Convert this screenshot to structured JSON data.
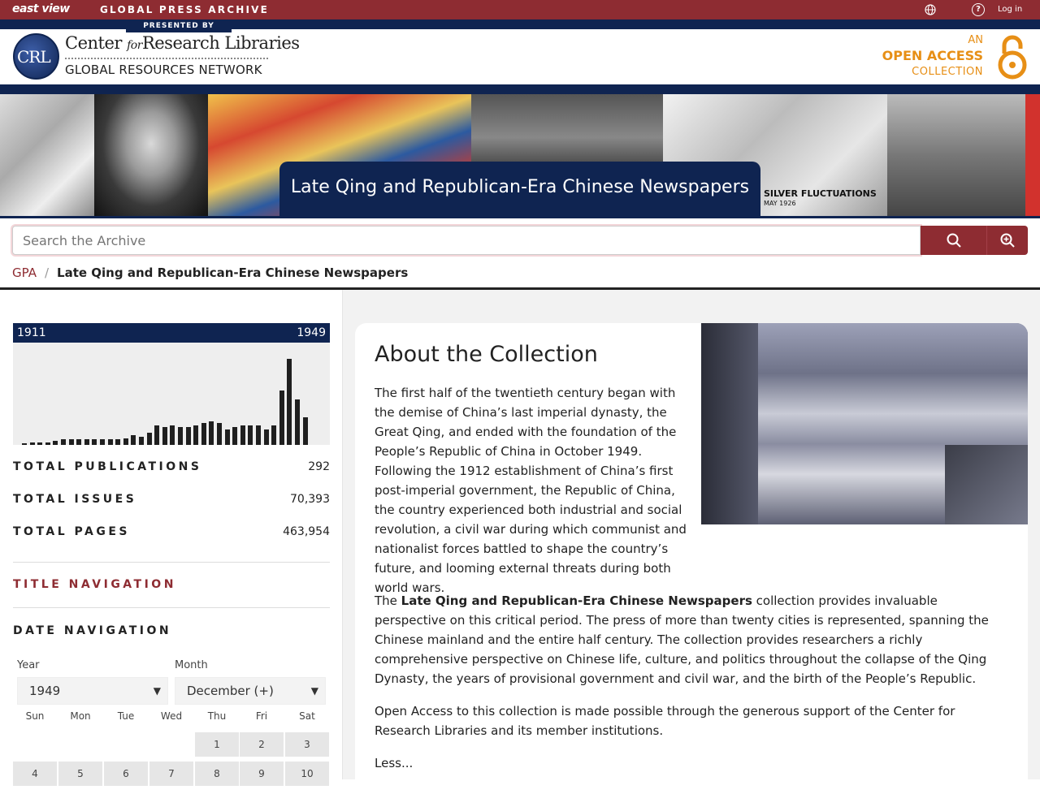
{
  "topbar": {
    "logo": "east view",
    "title": "GLOBAL PRESS ARCHIVE",
    "login": "Log in",
    "help": "?"
  },
  "header": {
    "presented_by": "PRESENTED BY",
    "crl_abbr": "CRL",
    "crl_line1_a": "Center",
    "crl_line1_for": "for",
    "crl_line1_b": "Research Libraries",
    "crl_line2": "GLOBAL RESOURCES NETWORK",
    "oa_line1": "AN",
    "oa_line2": "OPEN ACCESS",
    "oa_line3": "COLLECTION",
    "oa_color": "#e78f16"
  },
  "banner": {
    "title": "Late Qing and Republican-Era Chinese Newspapers",
    "caption": "SILVER FLUCTUATIONS",
    "caption_date": "MAY 1926"
  },
  "search": {
    "placeholder": "Search the Archive"
  },
  "breadcrumb": {
    "root": "GPA",
    "separator": "/",
    "current": "Late Qing and Republican-Era Chinese Newspapers"
  },
  "sidebar": {
    "range_start": "1911",
    "range_end": "1949",
    "histogram": [
      1,
      2,
      2,
      2,
      3,
      4,
      4,
      4,
      4,
      4,
      4,
      4,
      4,
      5,
      7,
      6,
      9,
      14,
      13,
      14,
      13,
      13,
      14,
      16,
      17,
      16,
      11,
      13,
      14,
      14,
      14,
      11,
      14,
      40,
      63,
      33,
      20
    ],
    "stats": [
      {
        "label": "TOTAL PUBLICATIONS",
        "value": "292"
      },
      {
        "label": "TOTAL ISSUES",
        "value": "70,393"
      },
      {
        "label": "TOTAL PAGES",
        "value": "463,954"
      }
    ],
    "title_navigation": "TITLE NAVIGATION",
    "date_navigation": "DATE NAVIGATION",
    "year_label": "Year",
    "year_value": "1949",
    "month_label": "Month",
    "month_value": "December (+)",
    "weekdays": [
      "Sun",
      "Mon",
      "Tue",
      "Wed",
      "Thu",
      "Fri",
      "Sat"
    ],
    "week1": [
      "",
      "",
      "",
      "",
      "1",
      "2",
      "3"
    ],
    "week2": [
      "4",
      "5",
      "6",
      "7",
      "8",
      "9",
      "10"
    ]
  },
  "about": {
    "heading": "About the Collection",
    "p1": "The first half of the twentieth century began with the demise of China’s last imperial dynasty, the Great Qing, and ended with the foundation of the People’s Republic of China in October 1949. Following the 1912 establishment of China’s first post-imperial government, the Republic of China, the country experienced both industrial and social revolution, a civil war during which communist and nationalist forces battled to shape the country’s future, and looming external threats during both world wars.",
    "p2_prefix": "The ",
    "p2_bold": "Late Qing and Republican-Era Chinese Newspapers",
    "p2_rest": " collection provides invaluable perspective on this critical period. The press of more than twenty cities is represented, spanning the Chinese mainland and the entire half century. The collection provides researchers a richly comprehensive perspective on Chinese life, culture, and politics throughout the collapse of the Qing Dynasty, the years of provisional government and civil war, and the birth of the People’s Republic.",
    "p3": "Open Access to this collection is made possible through the generous support of the Center for Research Libraries and its member institutions.",
    "less": "Less..."
  },
  "colors": {
    "brand_red": "#8e2c32",
    "navy": "#0f2451"
  }
}
